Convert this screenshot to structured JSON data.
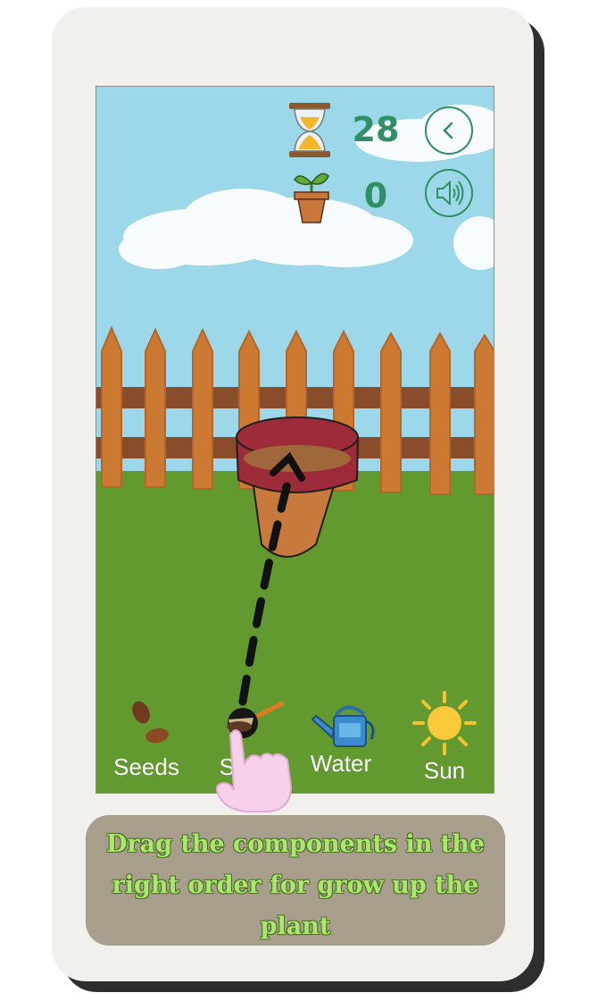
{
  "hud": {
    "timer_value": "28",
    "timer_icon": "hourglass-icon",
    "plants_value": "0",
    "plants_icon": "potted-plant-icon",
    "back_icon": "chevron-left-icon",
    "sound_icon": "speaker-icon"
  },
  "tools": [
    {
      "label": "Seeds",
      "icon": "seeds-icon"
    },
    {
      "label": "Sand",
      "icon": "soil-shovel-icon"
    },
    {
      "label": "Water",
      "icon": "watering-can-icon"
    },
    {
      "label": "Sun",
      "icon": "sun-icon"
    }
  ],
  "hint": {
    "line1": "Drag the components in the",
    "line2": "right order for grow up the",
    "line3": "plant"
  },
  "colors": {
    "sky": "#9dd8ea",
    "grass": "#639a2f",
    "fence": "#cc7a32",
    "accent": "#2f8f65",
    "hint_bg": "#a79f8c",
    "hint_text": "#a8e96a"
  }
}
